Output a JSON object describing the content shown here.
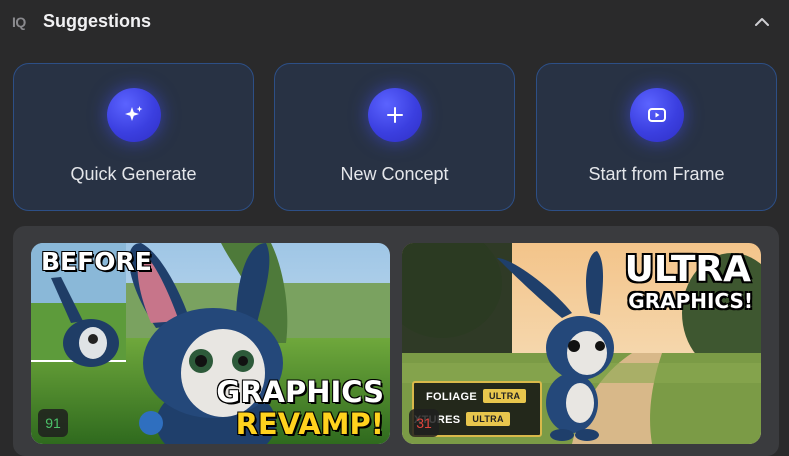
{
  "header": {
    "title": "Suggestions",
    "logo_text": "IQ"
  },
  "actions": [
    {
      "label": "Quick Generate",
      "icon": "sparkle-icon"
    },
    {
      "label": "New Concept",
      "icon": "plus-icon"
    },
    {
      "label": "Start from Frame",
      "icon": "video-frame-icon"
    }
  ],
  "thumbnails": [
    {
      "overlay_top": "BEFORE",
      "overlay_line1": "GRAPHICS",
      "overlay_line2": "REVAMP!",
      "score": "91",
      "score_color": "#4cc36a"
    },
    {
      "overlay_top1": "ULTRA",
      "overlay_top2": "GRAPHICS!",
      "settings": [
        {
          "name": "FOLIAGE",
          "value": "ULTRA"
        },
        {
          "name": "XTURES",
          "value": "ULTRA"
        }
      ],
      "score": "31",
      "score_color": "#e0453e"
    }
  ],
  "colors": {
    "accent": "#3b3fe0",
    "card_border": "#2d4f86"
  }
}
